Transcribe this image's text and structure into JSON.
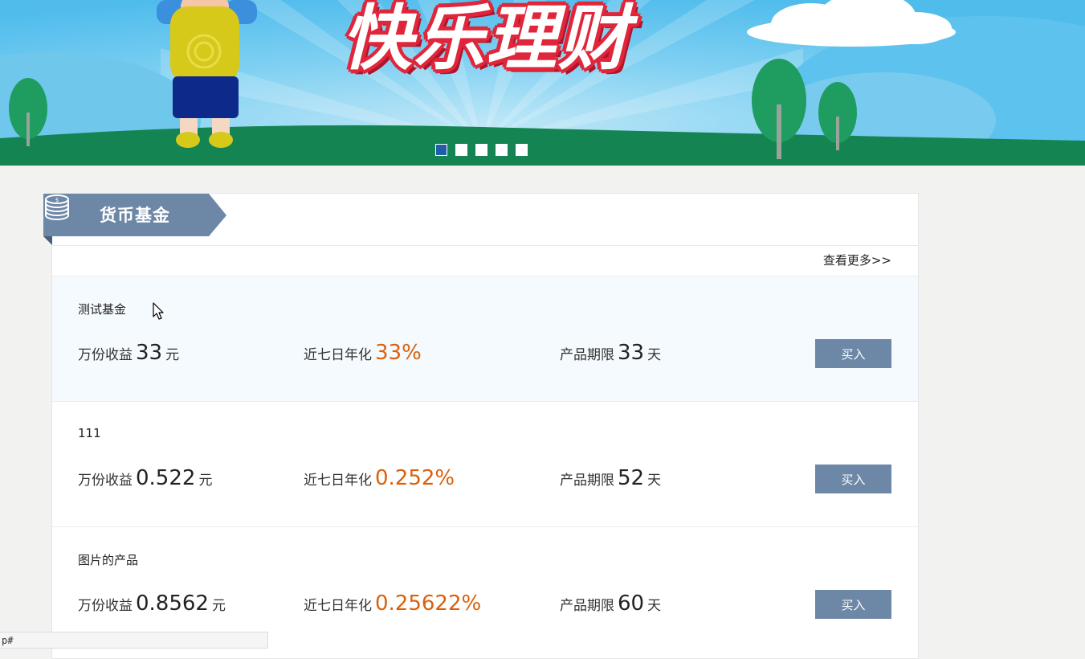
{
  "banner": {
    "title": "快乐理财",
    "slides": 5,
    "active_slide": 1
  },
  "section": {
    "title": "货币基金",
    "more_link": "查看更多>>"
  },
  "labels": {
    "income": "万份收益",
    "yield": "近七日年化",
    "term": "产品期限",
    "income_unit": "元",
    "term_unit": "天",
    "buy": "买入"
  },
  "funds": [
    {
      "name": "测试基金",
      "income": "33",
      "yield": "33%",
      "term": "33",
      "highlighted": true
    },
    {
      "name": "111",
      "income": "0.522",
      "yield": "0.252%",
      "term": "52",
      "highlighted": false
    },
    {
      "name": "图片的产品",
      "income": "0.8562",
      "yield": "0.25622%",
      "term": "60",
      "highlighted": false
    }
  ],
  "status_bar": {
    "url": "p#"
  },
  "colors": {
    "accent_orange": "#d9610d",
    "button": "#6d87a6",
    "section_tab": "#6d87a6",
    "active_dot": "#1e5fa8"
  }
}
